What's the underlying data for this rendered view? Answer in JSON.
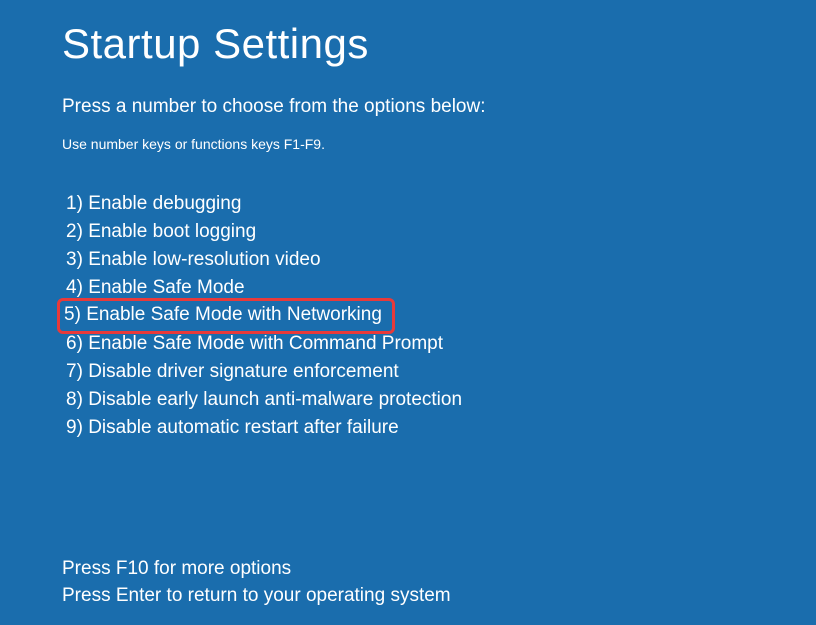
{
  "title": "Startup Settings",
  "subtitle": "Press a number to choose from the options below:",
  "hint": "Use number keys or functions keys F1-F9.",
  "options": [
    {
      "num": "1)",
      "label": "Enable debugging",
      "highlighted": false
    },
    {
      "num": "2)",
      "label": "Enable boot logging",
      "highlighted": false
    },
    {
      "num": "3)",
      "label": "Enable low-resolution video",
      "highlighted": false
    },
    {
      "num": "4)",
      "label": "Enable Safe Mode",
      "highlighted": false
    },
    {
      "num": "5)",
      "label": "Enable Safe Mode with Networking",
      "highlighted": true
    },
    {
      "num": "6)",
      "label": "Enable Safe Mode with Command Prompt",
      "highlighted": false
    },
    {
      "num": "7)",
      "label": "Disable driver signature enforcement",
      "highlighted": false
    },
    {
      "num": "8)",
      "label": "Disable early launch anti-malware protection",
      "highlighted": false
    },
    {
      "num": "9)",
      "label": "Disable automatic restart after failure",
      "highlighted": false
    }
  ],
  "footer": {
    "more": "Press F10 for more options",
    "return": "Press Enter to return to your operating system"
  }
}
